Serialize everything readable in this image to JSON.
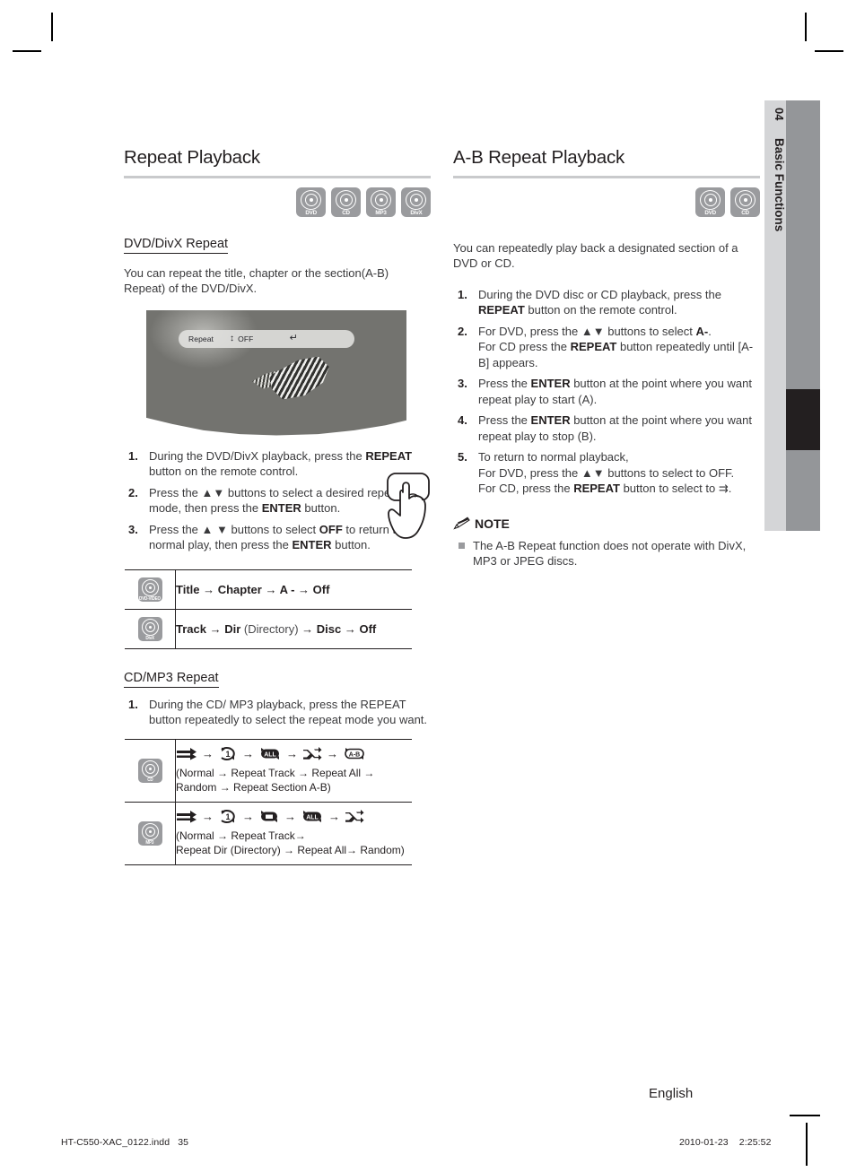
{
  "chapter_tab": {
    "number": "04",
    "name": "Basic Functions"
  },
  "left_column": {
    "title": "Repeat Playback",
    "disc_badges": [
      {
        "label": "DVD"
      },
      {
        "label": "CD"
      },
      {
        "label": "MP3"
      },
      {
        "label": "DivX"
      }
    ],
    "subheading": "DVD/DivX Repeat",
    "intro": "You can repeat the title, chapter or the section(A-B) Repeat) of the DVD/DivX.",
    "screenshot": {
      "osd_label": "Repeat",
      "osd_updown_icon": "up-down-arrow-icon",
      "osd_value": "OFF",
      "osd_return_icon": "return-icon"
    },
    "steps": [
      {
        "num": "1.",
        "parts": [
          {
            "t": "During the DVD/DivX playback, press the ",
            "b": false
          },
          {
            "t": "REPEAT",
            "b": true
          },
          {
            "t": " button on the remote control.",
            "b": false
          }
        ]
      },
      {
        "num": "2.",
        "parts": [
          {
            "t": "Press the ",
            "b": false
          },
          {
            "t": "▲▼",
            "b": false
          },
          {
            "t": " buttons to select a desired repeat mode, then press the ",
            "b": false
          },
          {
            "t": "ENTER",
            "b": true
          },
          {
            "t": " button.",
            "b": false
          }
        ]
      },
      {
        "num": "3.",
        "parts": [
          {
            "t": "Press the ",
            "b": false
          },
          {
            "t": "▲ ▼",
            "b": false
          },
          {
            "t": " buttons to select ",
            "b": false
          },
          {
            "t": "OFF",
            "b": true
          },
          {
            "t": " to return to normal play, then press the ",
            "b": false
          },
          {
            "t": "ENTER",
            "b": true
          },
          {
            "t": " button.",
            "b": false
          }
        ]
      }
    ],
    "mode_table_1": [
      {
        "disc": "DVD-VIDEO",
        "sequence_bold": "Title → Chapter → A - → Off",
        "sequence_light": ""
      },
      {
        "disc": "DivX",
        "sequence_bold": "Track → Dir",
        "sequence_light": " (Directory) ",
        "sequence_bold2": "→ Disc → Off"
      }
    ],
    "subheading2": "CD/MP3 Repeat",
    "steps2": [
      {
        "num": "1.",
        "parts": [
          {
            "t": "During the CD/ MP3 playback, press the REPEAT button repeatedly to select the repeat mode you want.",
            "b": false
          }
        ]
      }
    ],
    "mode_table_2": [
      {
        "disc": "CD",
        "icons": [
          "normal-icon",
          "repeat-track-icon",
          "repeat-all-icon",
          "random-icon",
          "repeat-ab-icon"
        ],
        "icon_labels": [
          "⇉",
          "1",
          "ALL",
          "⤨",
          "A-B"
        ],
        "caption_line1": "(Normal → Repeat Track → Repeat All →",
        "caption_line2": "Random → Repeat Section A-B)"
      },
      {
        "disc": "MP3",
        "icons": [
          "normal-icon",
          "repeat-track-icon",
          "repeat-dir-icon",
          "repeat-all-icon",
          "random-icon"
        ],
        "icon_labels": [
          "⇉",
          "1",
          "DIR",
          "ALL",
          "⤨"
        ],
        "caption_line1": "(Normal  → Repeat Track→",
        "caption_line2": "Repeat Dir (Directory) → Repeat All→ Random)"
      }
    ]
  },
  "right_column": {
    "title": "A-B Repeat Playback",
    "disc_badges": [
      {
        "label": "DVD"
      },
      {
        "label": "CD"
      }
    ],
    "intro": "You can repeatedly play back a designated section of a DVD or CD.",
    "steps": [
      {
        "num": "1.",
        "parts": [
          {
            "t": "During the DVD disc or CD playback, press the ",
            "b": false
          },
          {
            "t": "REPEAT",
            "b": true
          },
          {
            "t": " button on the remote control.",
            "b": false
          }
        ]
      },
      {
        "num": "2.",
        "parts": [
          {
            "t": "For DVD, press the ",
            "b": false
          },
          {
            "t": "▲▼",
            "b": false
          },
          {
            "t": " buttons to select ",
            "b": false
          },
          {
            "t": "A-",
            "b": true
          },
          {
            "t": ".",
            "b": false
          },
          {
            "t": "\n",
            "b": false
          },
          {
            "t": "For CD press the ",
            "b": false
          },
          {
            "t": "REPEAT",
            "b": true
          },
          {
            "t": " button repeatedly until ",
            "b": false
          },
          {
            "t": "[A-B]",
            "b": false
          },
          {
            "t": " appears.",
            "b": false
          }
        ]
      },
      {
        "num": "3.",
        "parts": [
          {
            "t": "Press the ",
            "b": false
          },
          {
            "t": "ENTER",
            "b": true
          },
          {
            "t": " button at the point where you want repeat play to start (A).",
            "b": false
          }
        ]
      },
      {
        "num": "4.",
        "parts": [
          {
            "t": "Press the ",
            "b": false
          },
          {
            "t": "ENTER",
            "b": true
          },
          {
            "t": " button at the point where you want repeat play to stop (B).",
            "b": false
          }
        ]
      },
      {
        "num": "5.",
        "parts": [
          {
            "t": "To return to normal playback,",
            "b": false
          },
          {
            "t": "\n",
            "b": false
          },
          {
            "t": "For DVD, press the ",
            "b": false
          },
          {
            "t": "▲▼",
            "b": false
          },
          {
            "t": " buttons to select to OFF.",
            "b": false
          },
          {
            "t": "\n",
            "b": false
          },
          {
            "t": "For CD, press the ",
            "b": false
          },
          {
            "t": "REPEAT",
            "b": true
          },
          {
            "t": " button to select to ",
            "b": false
          },
          {
            "t": "⇉",
            "b": false
          },
          {
            "t": ".",
            "b": false
          }
        ]
      }
    ],
    "note": {
      "icon": "pencil-icon",
      "heading": "NOTE",
      "items": [
        "The A-B Repeat function does not operate with DivX, MP3 or JPEG discs."
      ]
    }
  },
  "footer": {
    "language": "English",
    "file_name": "HT-C550-XAC_0122.indd",
    "page_number": "35",
    "date": "2010-01-23",
    "time": "2:25:52"
  },
  "colors": {
    "tab_light": "#d4d5d7",
    "tab_dark": "#949699",
    "tab_current": "#231f20",
    "rule": "#c9cacc",
    "disc_badge": "#9a9b9e",
    "text": "#231f20",
    "body_text": "#3a3a3c"
  }
}
